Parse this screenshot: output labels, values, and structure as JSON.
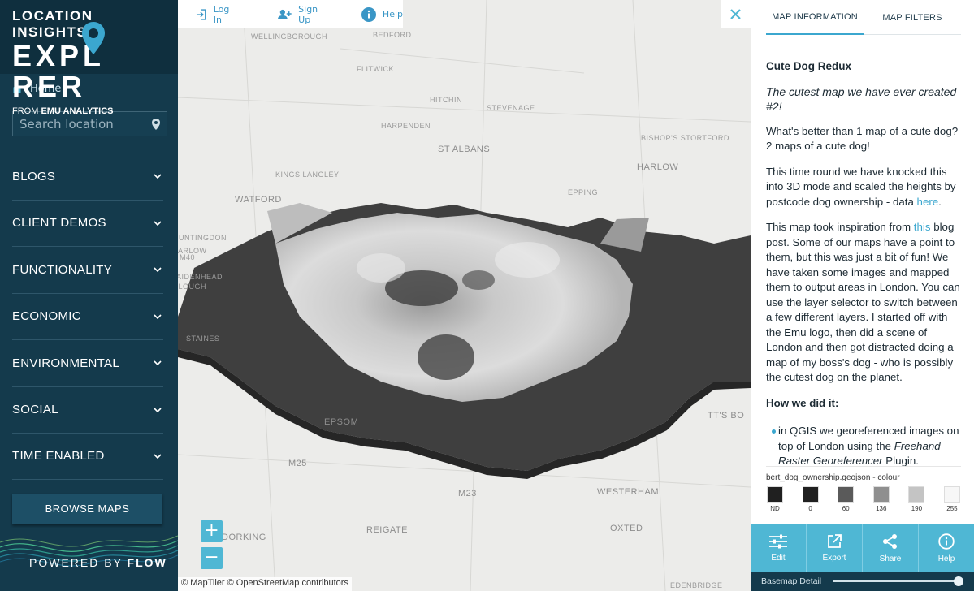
{
  "brand": {
    "line1": "LOCATION INSIGHTS",
    "line2": "EXPL    RER",
    "from_prefix": "FROM",
    "from_name": "EMU ANALYTICS"
  },
  "sidebar": {
    "home_label": "Home",
    "search_placeholder": "Search location",
    "nav": [
      "BLOGS",
      "CLIENT DEMOS",
      "FUNCTIONALITY",
      "ECONOMIC",
      "ENVIRONMENTAL",
      "SOCIAL",
      "TIME ENABLED"
    ],
    "browse_label": "BROWSE MAPS",
    "powered_prefix": "POWERED BY",
    "powered_name": "FLOW"
  },
  "topbar": {
    "login": "Log In",
    "signup": "Sign Up",
    "help": "Help"
  },
  "map": {
    "places": [
      "WELLINGBOROUGH",
      "BEDFORD",
      "FLITWICK",
      "HITCHIN",
      "STEVENAGE",
      "HARPENDEN",
      "BISHOP'S STORTFORD",
      "ST ALBANS",
      "HARLOW",
      "WATFORD",
      "KINGS LANGLEY",
      "EPPING",
      "STAINES",
      "EPSOM",
      "M25",
      "M23",
      "REIGATE",
      "DORKING",
      "OXTED",
      "WESTERHAM",
      "EDENBRIDGE",
      "M40",
      "SLOUGH",
      "MAIDENHEAD",
      "MARLOW",
      "HUNTINGDON",
      "TT'S BO"
    ],
    "zoom_in": "+",
    "zoom_out": "−",
    "attribution": "© MapTiler © OpenStreetMap contributors"
  },
  "panel": {
    "tabs": [
      "MAP INFORMATION",
      "MAP FILTERS"
    ],
    "title": "Cute Dog Redux",
    "subtitle": "The cutest map we have ever created #2!",
    "p1": "What's better than 1 map of a cute dog? 2 maps of a cute dog!",
    "p2_pre": "This time round we have knocked this into 3D mode and scaled the heights by postcode dog ownership - data ",
    "p2_link": "here",
    "p2_post": ".",
    "p3_pre": "This map took inspiration from ",
    "p3_link": "this",
    "p3_post": " blog post. Some of our maps have a point to them, but this was just a bit of fun! We have taken some images and mapped them to output areas in London. You can use the layer selector to switch between a few different layers. I started off with the Emu logo, then did a scene of London and then got distracted doing a map of my boss's dog - who is possibly the cutest dog on the planet.",
    "how_heading": "How we did it:",
    "bullet_pre": "in QGIS we georeferenced images on top of London using the ",
    "bullet_italic": "Freehand Raster Georeferencer",
    "bullet_post": " Plugin.",
    "legend_title": "bert_dog_ownership.geojson - colour",
    "legend": [
      {
        "label": "ND",
        "color": "#202020"
      },
      {
        "label": "0",
        "color": "#202020"
      },
      {
        "label": "60",
        "color": "#5a5a5a"
      },
      {
        "label": "136",
        "color": "#8f8f8f"
      },
      {
        "label": "190",
        "color": "#c4c4c4"
      },
      {
        "label": "255",
        "color": "#f7f7f7"
      }
    ],
    "actions": [
      "Edit",
      "Export",
      "Share",
      "Help"
    ],
    "basemap_label": "Basemap Detail",
    "basemap_level": 0.96
  },
  "colors": {
    "accent": "#4fb7d4",
    "sidebar": "#143a4c",
    "link": "#3ba7cf"
  }
}
